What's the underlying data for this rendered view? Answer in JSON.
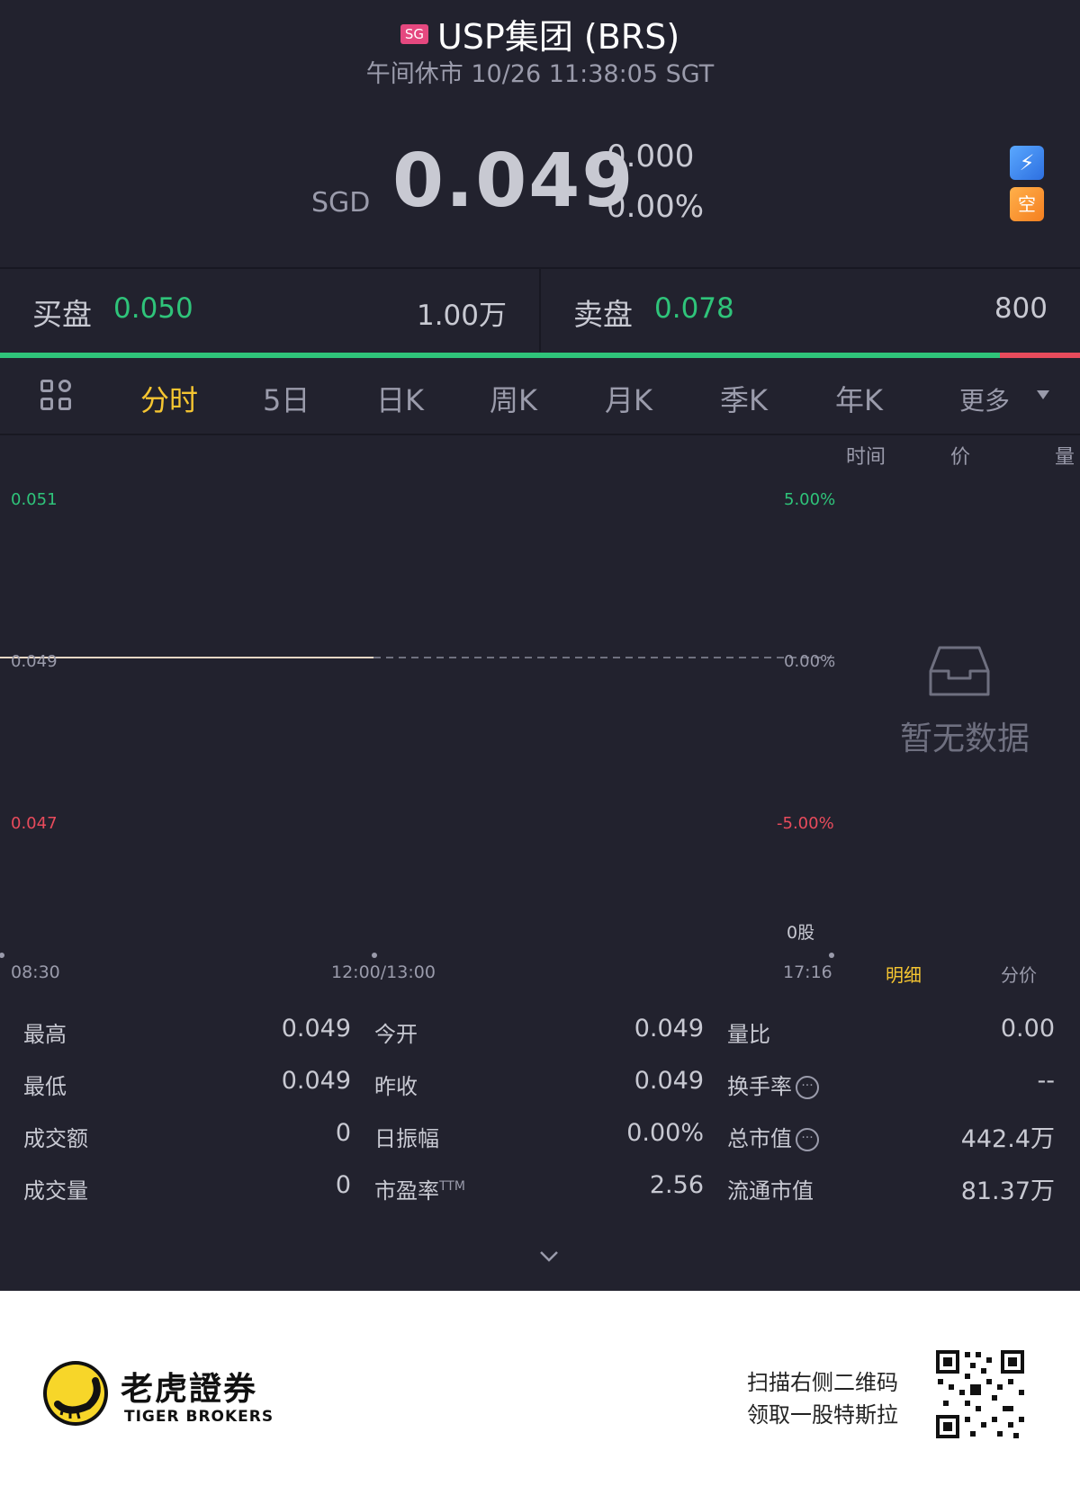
{
  "header": {
    "market_badge": "SG",
    "title": "USP集团 (BRS)",
    "status": "午间休市 10/26 11:38:05 SGT"
  },
  "quote": {
    "currency": "SGD",
    "price": "0.049",
    "change": "0.000",
    "change_pct": "0.00%"
  },
  "bid": {
    "label": "买盘",
    "price": "0.050",
    "size": "1.00万"
  },
  "ask": {
    "label": "卖盘",
    "price": "0.078",
    "size": "800"
  },
  "tabs": {
    "intraday": "分时",
    "five_day": "5日",
    "day_k": "日K",
    "week_k": "周K",
    "month_k": "月K",
    "quarter_k": "季K",
    "year_k": "年K",
    "more": "更多"
  },
  "chart": {
    "y_high": "0.051",
    "y_mid": "0.049",
    "y_low": "0.047",
    "pct_high": "5.00%",
    "pct_mid": "0.00%",
    "pct_low": "-5.00%",
    "time_start": "08:30",
    "time_mid": "12:00/13:00",
    "time_end": "17:16",
    "volume": "0股"
  },
  "trades_panel": {
    "col_time": "时间",
    "col_price": "价",
    "col_volume": "量",
    "empty_text": "暂无数据",
    "tab_detail": "明细",
    "tab_price": "分价"
  },
  "stats": {
    "high_label": "最高",
    "high_value": "0.049",
    "low_label": "最低",
    "low_value": "0.049",
    "turnover_label": "成交额",
    "turnover_value": "0",
    "volume_label": "成交量",
    "volume_value": "0",
    "open_label": "今开",
    "open_value": "0.049",
    "prev_close_label": "昨收",
    "prev_close_value": "0.049",
    "amplitude_label": "日振幅",
    "amplitude_value": "0.00%",
    "pe_label": "市盈率",
    "pe_suffix": "TTM",
    "pe_value": "2.56",
    "vol_ratio_label": "量比",
    "vol_ratio_value": "0.00",
    "turnover_rate_label": "换手率",
    "turnover_rate_value": "--",
    "market_cap_label": "总市值",
    "market_cap_value": "442.4万",
    "float_cap_label": "流通市值",
    "float_cap_value": "81.37万"
  },
  "footer": {
    "brand_cn": "老虎證券",
    "brand_en": "TIGER BROKERS",
    "promo_line1": "扫描右侧二维码",
    "promo_line2": "领取一股特斯拉"
  },
  "colors": {
    "background": "#22222e",
    "up_green": "#2fc47a",
    "down_red": "#e84b5c",
    "active_tab": "#f5c531"
  },
  "icons": [
    "sg-badge",
    "lightning-icon",
    "empty-icon",
    "grid-icon",
    "dropdown-icon",
    "nodata-icon",
    "dots-icon",
    "chevron-down-icon",
    "tiger-logo-icon",
    "qr-code"
  ]
}
